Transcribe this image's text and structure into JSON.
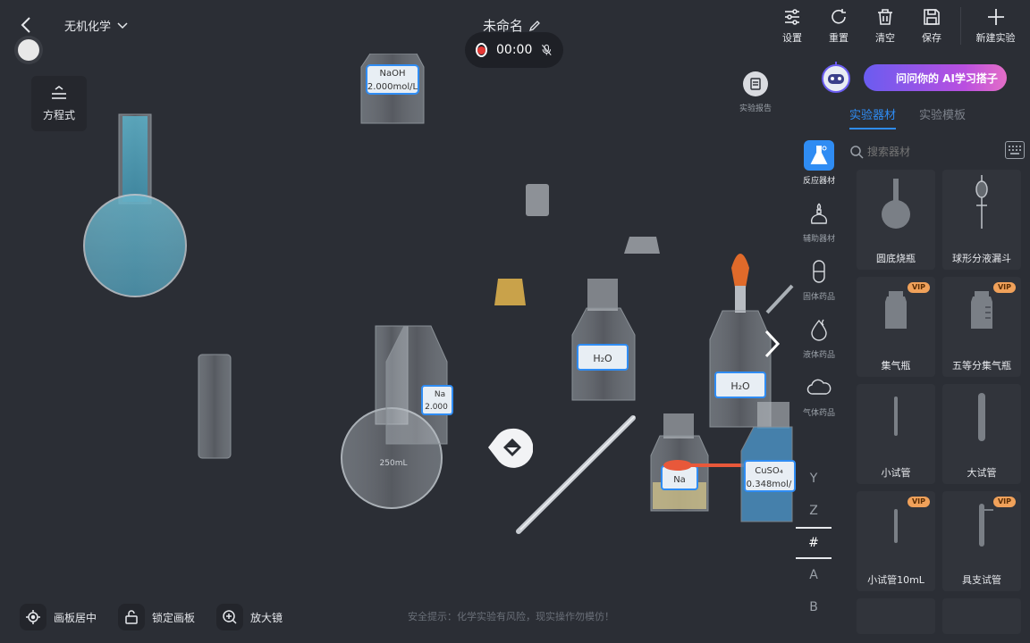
{
  "header": {
    "course": "无机化学",
    "title": "未命名",
    "record_time": "00:00",
    "tools": [
      {
        "icon": "settings-icon",
        "label": "设置"
      },
      {
        "icon": "reset-icon",
        "label": "重置"
      },
      {
        "icon": "trash-icon",
        "label": "清空"
      },
      {
        "icon": "save-icon",
        "label": "保存"
      }
    ],
    "new_experiment": "新建实验"
  },
  "equation_button": "方程式",
  "report_button": "实验报告",
  "canvas": {
    "naoh_label_1": "NaOH",
    "naoh_label_2": "2.000mol/L",
    "h2o_label_1": "H₂O",
    "h2o_label_2": "H₂O",
    "na_label": "Na",
    "cuso4_label_1": "CuSO₄",
    "cuso4_label_2": "0.348mol/",
    "na2_label_1": "Na",
    "na2_label_2": "2.000",
    "flask_volume": "250mL"
  },
  "categories": [
    {
      "icon": "reaction-icon",
      "label": "反应器材"
    },
    {
      "icon": "burner-icon",
      "label": "辅助器材"
    },
    {
      "icon": "capsule-icon",
      "label": "固体药品"
    },
    {
      "icon": "drop-icon",
      "label": "液体药品"
    },
    {
      "icon": "cloud-icon",
      "label": "气体药品"
    }
  ],
  "letters": [
    "Y",
    "Z",
    "#",
    "A",
    "B"
  ],
  "panel": {
    "ai_banner": "问问你的 AI学习搭子",
    "tabs": [
      "实验器材",
      "实验模板"
    ],
    "search_placeholder": "搜索器材",
    "vip_tag": "VIP",
    "items": [
      {
        "label": "圆底烧瓶",
        "icon": "round-bottom-flask-icon",
        "vip": false
      },
      {
        "label": "球形分液漏斗",
        "icon": "separatory-funnel-icon",
        "vip": false
      },
      {
        "label": "集气瓶",
        "icon": "gas-jar-icon",
        "vip": true
      },
      {
        "label": "五等分集气瓶",
        "icon": "graduated-gas-jar-icon",
        "vip": true
      },
      {
        "label": "小试管",
        "icon": "small-test-tube-icon",
        "vip": false
      },
      {
        "label": "大试管",
        "icon": "large-test-tube-icon",
        "vip": false
      },
      {
        "label": "小试管10mL",
        "icon": "test-tube-10ml-icon",
        "vip": true
      },
      {
        "label": "具支试管",
        "icon": "side-arm-tube-icon",
        "vip": true
      }
    ]
  },
  "bottom": {
    "center": "画板居中",
    "lock": "锁定画板",
    "zoom": "放大镜",
    "safety": "安全提示：化学实验有风险，现实操作勿模仿！"
  },
  "colors": {
    "accent": "#2f8cf3",
    "vip": "#f0a15a",
    "background": "#2b2e35"
  }
}
